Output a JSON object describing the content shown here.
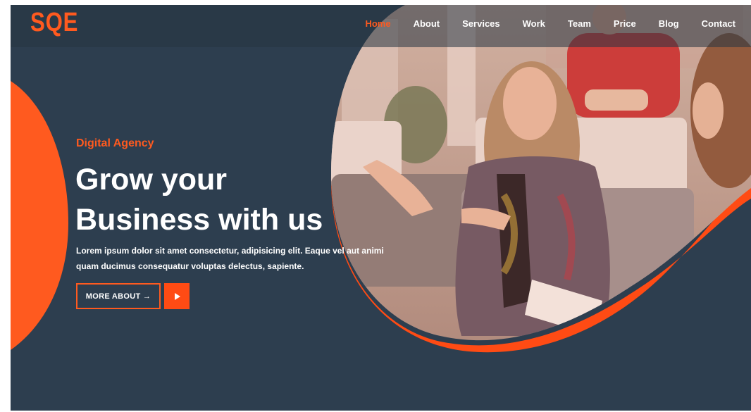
{
  "brand": {
    "logo_text": "SQE"
  },
  "nav": {
    "items": [
      {
        "label": "Home",
        "active": true
      },
      {
        "label": "About"
      },
      {
        "label": "Services"
      },
      {
        "label": "Work"
      },
      {
        "label": "Team"
      },
      {
        "label": "Price"
      },
      {
        "label": "Blog"
      },
      {
        "label": "Contact"
      }
    ]
  },
  "hero": {
    "eyebrow": "Digital Agency",
    "headline_line1": "Grow your",
    "headline_line2": "Business with us",
    "lede": "Lorem ipsum dolor sit amet consectetur, adipisicing elit. Eaque vel aut animi quam ducimus consequatur voluptas delectus, sapiente.",
    "more_button": "MORE ABOUT →",
    "play_icon": "play-icon"
  },
  "colors": {
    "background": "#2d3e4f",
    "accent": "#ff5a1f",
    "text": "#ffffff"
  }
}
